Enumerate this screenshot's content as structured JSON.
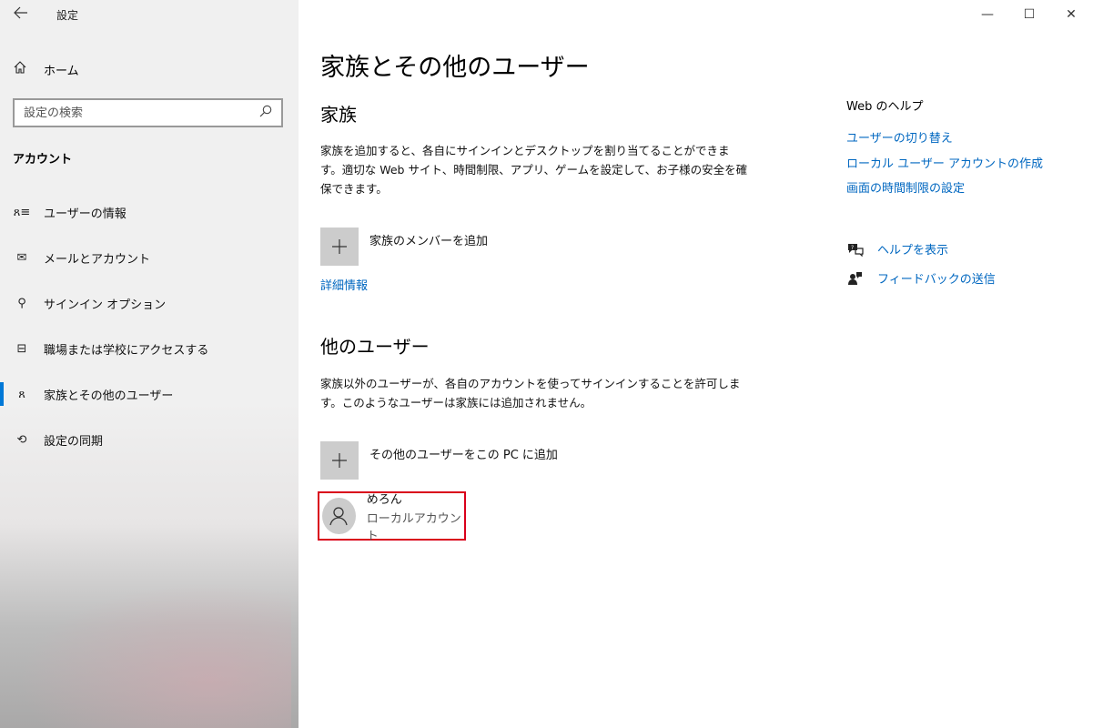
{
  "window": {
    "title": "設定",
    "back_icon": "back-arrow-icon",
    "minimize": "—",
    "maximize": "☐",
    "close": "✕"
  },
  "sidebar": {
    "home_label": "ホーム",
    "search_placeholder": "設定の検索",
    "section": "アカウント",
    "items": [
      {
        "label": "ユーザーの情報",
        "icon": "user-info-icon",
        "glyph": "ጸ≡"
      },
      {
        "label": "メールとアカウント",
        "icon": "mail-icon",
        "glyph": "✉"
      },
      {
        "label": "サインイン オプション",
        "icon": "key-icon",
        "glyph": "⚲"
      },
      {
        "label": "職場または学校にアクセスする",
        "icon": "briefcase-icon",
        "glyph": "⊟"
      },
      {
        "label": "家族とその他のユーザー",
        "icon": "add-user-icon",
        "glyph": "ጸ"
      },
      {
        "label": "設定の同期",
        "icon": "sync-icon",
        "glyph": "⟲"
      }
    ],
    "active_index": 4
  },
  "main": {
    "title": "家族とその他のユーザー",
    "family": {
      "heading": "家族",
      "description": "家族を追加すると、各自にサインインとデスクトップを割り当てることができます。適切な Web サイト、時間制限、アプリ、ゲームを設定して、お子様の安全を確保できます。",
      "add_label": "家族のメンバーを追加",
      "details_link": "詳細情報"
    },
    "others": {
      "heading": "他のユーザー",
      "description": "家族以外のユーザーが、各自のアカウントを使ってサインインすることを許可します。このようなユーザーは家族には追加されません。",
      "add_label": "その他のユーザーをこの PC に追加",
      "users": [
        {
          "name": "めろん",
          "type": "ローカルアカウント"
        }
      ]
    }
  },
  "help": {
    "title": "Web のヘルプ",
    "links": [
      "ユーザーの切り替え",
      "ローカル ユーザー アカウントの作成",
      "画面の時間制限の設定"
    ],
    "get_help": "ヘルプを表示",
    "feedback": "フィードバックの送信"
  },
  "colors": {
    "accent": "#0078d7",
    "link": "#0067c0",
    "highlight_border": "#d9001b"
  }
}
